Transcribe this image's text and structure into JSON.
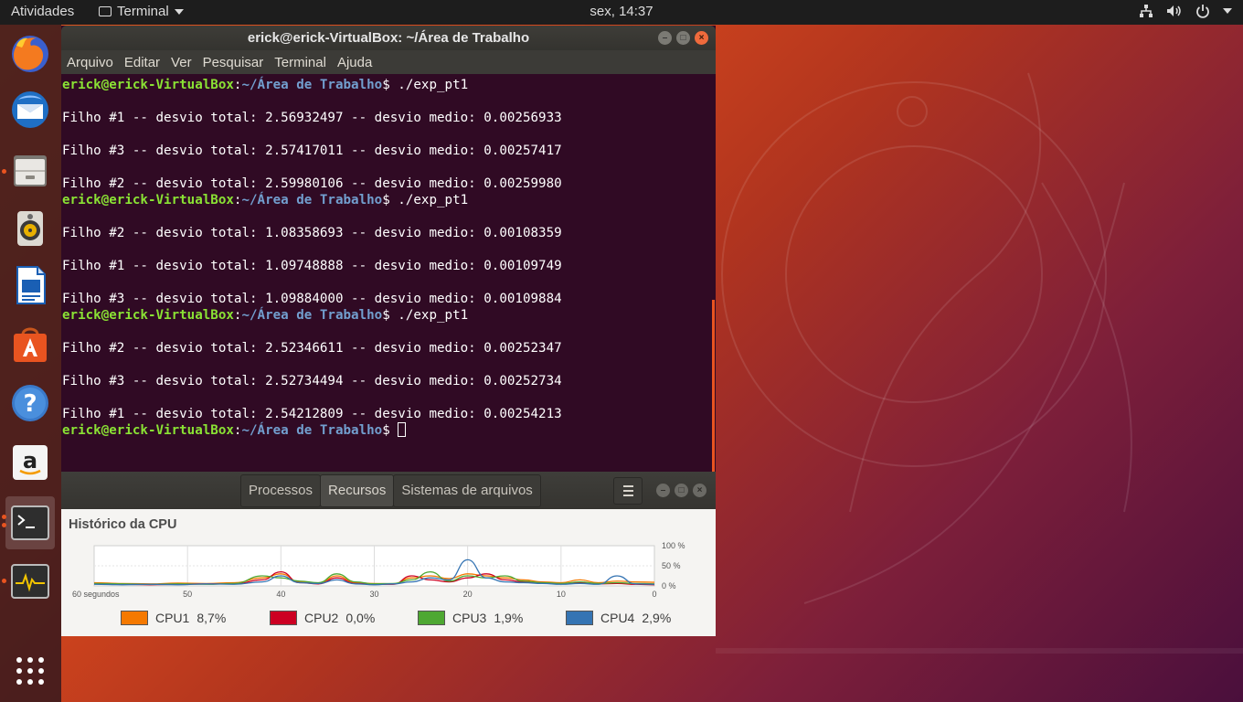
{
  "topbar": {
    "activities": "Atividades",
    "app_name": "Terminal",
    "clock": "sex, 14:37"
  },
  "dock": {
    "items": [
      {
        "name": "firefox-icon"
      },
      {
        "name": "thunderbird-icon"
      },
      {
        "name": "files-icon"
      },
      {
        "name": "rhythmbox-icon"
      },
      {
        "name": "libreoffice-writer-icon"
      },
      {
        "name": "software-center-icon"
      },
      {
        "name": "help-icon"
      },
      {
        "name": "amazon-icon"
      },
      {
        "name": "terminal-icon"
      },
      {
        "name": "system-monitor-icon"
      },
      {
        "name": "show-applications-icon"
      }
    ]
  },
  "terminal": {
    "title": "erick@erick-VirtualBox: ~/Área de Trabalho",
    "menu": [
      "Arquivo",
      "Editar",
      "Ver",
      "Pesquisar",
      "Terminal",
      "Ajuda"
    ],
    "prompt_user": "erick@erick-VirtualBox",
    "prompt_path": "~/Área de Trabalho",
    "command": "./exp_pt1",
    "lines": [
      {
        "type": "prompt",
        "cmd": "./exp_pt1"
      },
      {
        "type": "blank"
      },
      {
        "type": "out",
        "text": "Filho #1 -- desvio total: 2.56932497 -- desvio medio: 0.00256933"
      },
      {
        "type": "blank"
      },
      {
        "type": "out",
        "text": "Filho #3 -- desvio total: 2.57417011 -- desvio medio: 0.00257417"
      },
      {
        "type": "blank"
      },
      {
        "type": "out",
        "text": "Filho #2 -- desvio total: 2.59980106 -- desvio medio: 0.00259980"
      },
      {
        "type": "prompt",
        "cmd": "./exp_pt1"
      },
      {
        "type": "blank"
      },
      {
        "type": "out",
        "text": "Filho #2 -- desvio total: 1.08358693 -- desvio medio: 0.00108359"
      },
      {
        "type": "blank"
      },
      {
        "type": "out",
        "text": "Filho #1 -- desvio total: 1.09748888 -- desvio medio: 0.00109749"
      },
      {
        "type": "blank"
      },
      {
        "type": "out",
        "text": "Filho #3 -- desvio total: 1.09884000 -- desvio medio: 0.00109884"
      },
      {
        "type": "prompt",
        "cmd": "./exp_pt1"
      },
      {
        "type": "blank"
      },
      {
        "type": "out",
        "text": "Filho #2 -- desvio total: 2.52346611 -- desvio medio: 0.00252347"
      },
      {
        "type": "blank"
      },
      {
        "type": "out",
        "text": "Filho #3 -- desvio total: 2.52734494 -- desvio medio: 0.00252734"
      },
      {
        "type": "blank"
      },
      {
        "type": "out",
        "text": "Filho #1 -- desvio total: 2.54212809 -- desvio medio: 0.00254213"
      },
      {
        "type": "prompt",
        "cmd": "",
        "cursor": true
      }
    ]
  },
  "sysmon": {
    "tabs": [
      "Processos",
      "Recursos",
      "Sistemas de arquivos"
    ],
    "selected_tab": "Recursos",
    "section_title": "Histórico da CPU",
    "legend": [
      {
        "label": "CPU1",
        "value": "8,7%",
        "color": "#f57900"
      },
      {
        "label": "CPU2",
        "value": "0,0%",
        "color": "#cc0022"
      },
      {
        "label": "CPU3",
        "value": "1,9%",
        "color": "#4ea832"
      },
      {
        "label": "CPU4",
        "value": "2,9%",
        "color": "#3574b3"
      }
    ]
  },
  "chart_data": {
    "type": "line",
    "title": "Histórico da CPU",
    "x_tick_labels": [
      "60 segundos",
      "50",
      "40",
      "30",
      "20",
      "10",
      "0"
    ],
    "y_tick_labels": [
      "100 %",
      "50 %",
      "0 %"
    ],
    "xlim": [
      60,
      0
    ],
    "ylim": [
      0,
      100
    ],
    "grid": true,
    "x": [
      60,
      57,
      54,
      51,
      48,
      45,
      42,
      40,
      38,
      36,
      34,
      32,
      30,
      28,
      26,
      24,
      22,
      20,
      18,
      16,
      14,
      12,
      10,
      8,
      6,
      4,
      2,
      0
    ],
    "series": [
      {
        "name": "CPU1",
        "color": "#f57900",
        "values": [
          8,
          6,
          5,
          7,
          6,
          8,
          20,
          30,
          10,
          6,
          25,
          8,
          6,
          5,
          20,
          25,
          18,
          30,
          25,
          20,
          15,
          10,
          8,
          15,
          8,
          12,
          10,
          9
        ]
      },
      {
        "name": "CPU2",
        "color": "#cc0022",
        "values": [
          5,
          4,
          3,
          4,
          5,
          5,
          15,
          35,
          8,
          5,
          20,
          6,
          4,
          4,
          25,
          15,
          10,
          20,
          30,
          15,
          10,
          8,
          5,
          8,
          5,
          6,
          4,
          3
        ]
      },
      {
        "name": "CPU3",
        "color": "#4ea832",
        "values": [
          6,
          5,
          4,
          5,
          4,
          6,
          25,
          20,
          12,
          8,
          30,
          10,
          5,
          6,
          15,
          35,
          12,
          25,
          20,
          25,
          12,
          8,
          6,
          10,
          6,
          8,
          6,
          5
        ]
      },
      {
        "name": "CPU4",
        "color": "#3574b3",
        "values": [
          4,
          3,
          4,
          3,
          5,
          4,
          10,
          25,
          8,
          6,
          15,
          5,
          3,
          5,
          10,
          20,
          15,
          65,
          20,
          10,
          8,
          6,
          4,
          6,
          4,
          25,
          5,
          4
        ]
      }
    ]
  }
}
